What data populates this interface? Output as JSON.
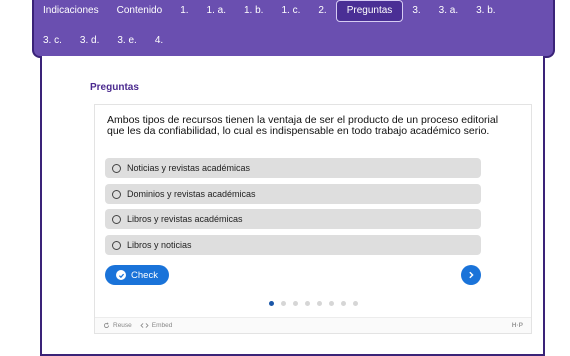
{
  "nav": {
    "row1": [
      "Indicaciones",
      "Contenido",
      "1.",
      "1. a.",
      "1. b.",
      "1. c.",
      "2.",
      "Preguntas",
      "3.",
      "3. a.",
      "3. b."
    ],
    "row2": [
      "3. c.",
      "3. d.",
      "3. e.",
      "4."
    ],
    "active": "Preguntas"
  },
  "section_title": "Preguntas",
  "question": "Ambos tipos de recursos tienen la ventaja de ser el producto de un proceso editorial que les da confiabilidad, lo cual es indispensable en todo trabajo académico serio.",
  "answers": [
    "Noticias y revistas académicas",
    "Dominios y revistas académicas",
    "Libros y revistas académicas",
    "Libros y noticias"
  ],
  "check_label": "Check",
  "pagination": {
    "total": 8,
    "current": 1
  },
  "footer": {
    "reuse_label": "Reuse",
    "embed_label": "Embed",
    "brand": "H·P"
  },
  "colors": {
    "nav_bg": "#6a4fb0",
    "nav_border": "#3a2378",
    "accent": "#1a73d9",
    "title": "#4b2a8f"
  }
}
